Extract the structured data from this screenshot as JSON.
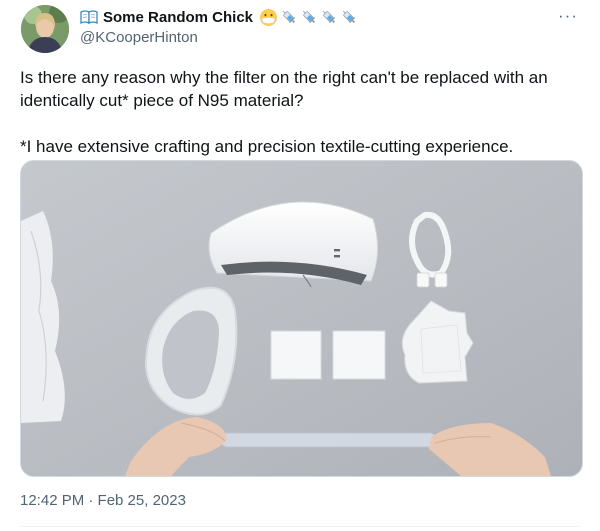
{
  "tweet": {
    "author": {
      "display_name": "Some Random Chick",
      "handle": "@KCooperHinton",
      "badges": [
        "open-book-emoji",
        "face-with-mask-emoji",
        "syringe-emoji",
        "syringe-emoji",
        "syringe-emoji",
        "syringe-emoji"
      ]
    },
    "more_icon": "more-options-icon",
    "paragraphs": [
      "Is there any reason why the filter on the right can't be replaced with an identically cut* piece of N95 material?",
      "*I have extensive crafting and precision textile-cutting experience."
    ],
    "media": {
      "image_subject": "mask-kit-flatlay"
    },
    "timestamp": "12:42 PM · Feb 25, 2023"
  }
}
